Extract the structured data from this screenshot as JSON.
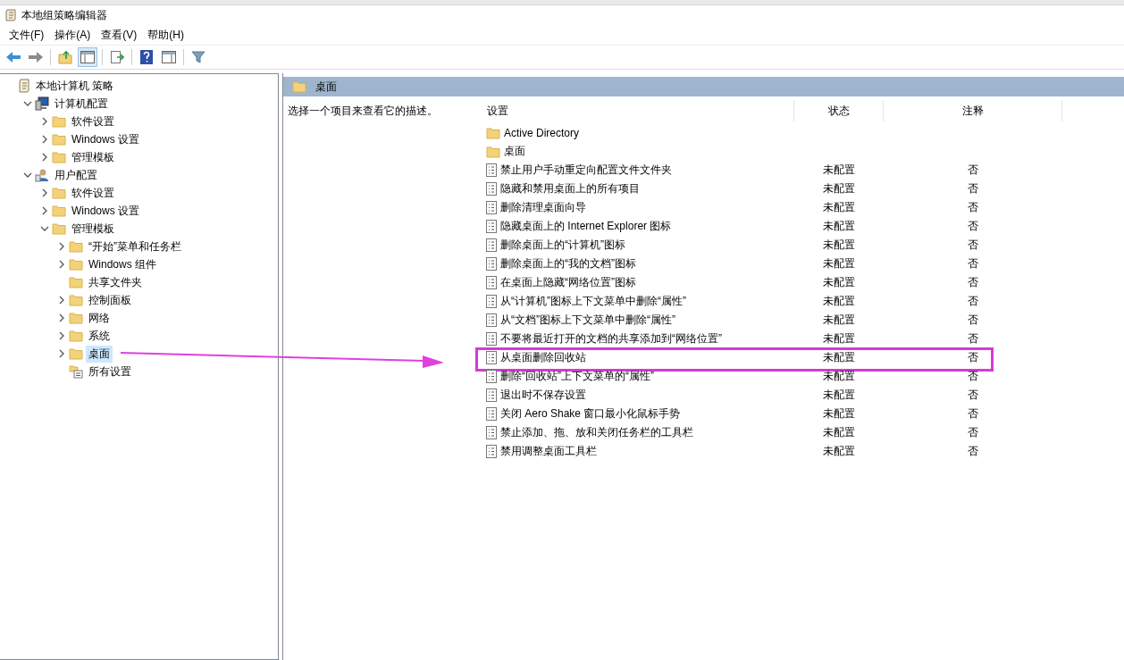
{
  "window": {
    "title": "本地组策略编辑器"
  },
  "menu": [
    "文件(F)",
    "操作(A)",
    "查看(V)",
    "帮助(H)"
  ],
  "tree": [
    {
      "label": "本地计算机 策略",
      "kind": "policy",
      "selected": false,
      "children": [
        {
          "label": "计算机配置",
          "kind": "computer",
          "expanded": true,
          "selected": false,
          "children": [
            {
              "label": "软件设置",
              "kind": "folder",
              "expanded": false,
              "selected": false
            },
            {
              "label": "Windows 设置",
              "kind": "folder",
              "expanded": false,
              "selected": false
            },
            {
              "label": "管理模板",
              "kind": "folder",
              "expanded": false,
              "selected": false
            }
          ]
        },
        {
          "label": "用户配置",
          "kind": "user",
          "expanded": true,
          "selected": false,
          "children": [
            {
              "label": "软件设置",
              "kind": "folder",
              "expanded": false,
              "selected": false
            },
            {
              "label": "Windows 设置",
              "kind": "folder",
              "expanded": false,
              "selected": false
            },
            {
              "label": "管理模板",
              "kind": "folder",
              "expanded": true,
              "selected": false,
              "children": [
                {
                  "label": "“开始”菜单和任务栏",
                  "kind": "folder",
                  "expanded": false,
                  "selected": false
                },
                {
                  "label": "Windows 组件",
                  "kind": "folder",
                  "expanded": false,
                  "selected": false
                },
                {
                  "label": "共享文件夹",
                  "kind": "folder",
                  "selected": false
                },
                {
                  "label": "控制面板",
                  "kind": "folder",
                  "expanded": false,
                  "selected": false
                },
                {
                  "label": "网络",
                  "kind": "folder",
                  "expanded": false,
                  "selected": false
                },
                {
                  "label": "系统",
                  "kind": "folder",
                  "expanded": false,
                  "selected": false
                },
                {
                  "label": "桌面",
                  "kind": "folder",
                  "expanded": false,
                  "selected": true,
                  "annotated": true
                },
                {
                  "label": "所有设置",
                  "kind": "settings",
                  "selected": false
                }
              ]
            }
          ]
        }
      ]
    }
  ],
  "details": {
    "title": "桌面",
    "description": "选择一个项目来查看它的描述。",
    "columns": [
      "设置",
      "状态",
      "注释"
    ],
    "rows": [
      {
        "kind": "folder",
        "name": "Active Directory",
        "highlighted": false
      },
      {
        "kind": "folder",
        "name": "桌面",
        "highlighted": false
      },
      {
        "kind": "setting",
        "name": "禁止用户手动重定向配置文件文件夹",
        "state": "未配置",
        "comment": "否",
        "highlighted": false
      },
      {
        "kind": "setting",
        "name": "隐藏和禁用桌面上的所有项目",
        "state": "未配置",
        "comment": "否",
        "highlighted": false
      },
      {
        "kind": "setting",
        "name": "删除清理桌面向导",
        "state": "未配置",
        "comment": "否",
        "highlighted": false
      },
      {
        "kind": "setting",
        "name": "隐藏桌面上的 Internet Explorer 图标",
        "state": "未配置",
        "comment": "否",
        "highlighted": false
      },
      {
        "kind": "setting",
        "name": "删除桌面上的“计算机”图标",
        "state": "未配置",
        "comment": "否",
        "highlighted": false
      },
      {
        "kind": "setting",
        "name": "删除桌面上的“我的文档”图标",
        "state": "未配置",
        "comment": "否",
        "highlighted": false
      },
      {
        "kind": "setting",
        "name": "在桌面上隐藏“网络位置”图标",
        "state": "未配置",
        "comment": "否",
        "highlighted": false
      },
      {
        "kind": "setting",
        "name": "从“计算机”图标上下文菜单中删除“属性”",
        "state": "未配置",
        "comment": "否",
        "highlighted": false
      },
      {
        "kind": "setting",
        "name": "从“文档”图标上下文菜单中删除“属性”",
        "state": "未配置",
        "comment": "否",
        "highlighted": false
      },
      {
        "kind": "setting",
        "name": "不要将最近打开的文档的共享添加到“网络位置”",
        "state": "未配置",
        "comment": "否",
        "highlighted": false
      },
      {
        "kind": "setting",
        "name": "从桌面删除回收站",
        "state": "未配置",
        "comment": "否",
        "highlighted": true
      },
      {
        "kind": "setting",
        "name": "删除“回收站”上下文菜单的“属性”",
        "state": "未配置",
        "comment": "否",
        "highlighted": false
      },
      {
        "kind": "setting",
        "name": "退出时不保存设置",
        "state": "未配置",
        "comment": "否",
        "highlighted": false
      },
      {
        "kind": "setting",
        "name": "关闭 Aero Shake 窗口最小化鼠标手势",
        "state": "未配置",
        "comment": "否",
        "highlighted": false
      },
      {
        "kind": "setting",
        "name": "禁止添加、拖、放和关闭任务栏的工具栏",
        "state": "未配置",
        "comment": "否",
        "highlighted": false
      },
      {
        "kind": "setting",
        "name": "禁用调整桌面工具栏",
        "state": "未配置",
        "comment": "否",
        "highlighted": false
      }
    ]
  }
}
